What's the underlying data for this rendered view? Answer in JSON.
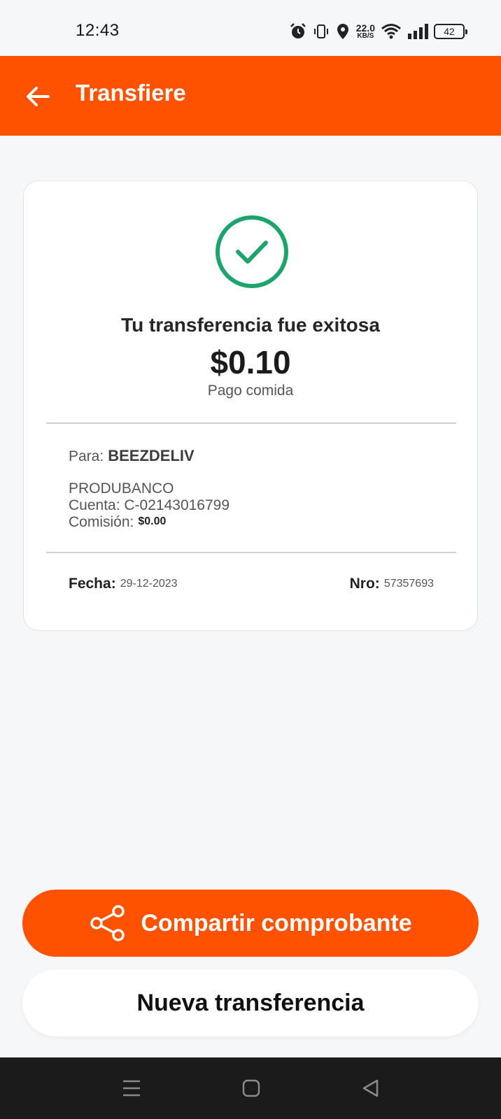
{
  "status_bar": {
    "time": "12:43",
    "net_speed_value": "22.0",
    "net_speed_unit": "KB/S",
    "battery": "42"
  },
  "app_bar": {
    "title": "Transfiere",
    "back_icon": "arrow-left-icon"
  },
  "receipt": {
    "success_icon": "check-circle-icon",
    "title": "Tu transferencia fue exitosa",
    "amount": "$0.10",
    "concept": "Pago comida",
    "para_label": "Para:",
    "recipient": "BEEZDELIV",
    "bank": "PRODUBANCO",
    "account": "Cuenta: C-02143016799",
    "fee_label": "Comisión:",
    "fee_value": "$0.00",
    "date_label": "Fecha:",
    "date_value": "29-12-2023",
    "nro_label": "Nro:",
    "nro_value": "57357693"
  },
  "actions": {
    "share_label": "Compartir comprobante",
    "share_icon": "share-icon",
    "new_label": "Nueva transferencia"
  },
  "colors": {
    "brand": "#ff5200",
    "success": "#1fa36d",
    "background": "#f6f7f9"
  }
}
